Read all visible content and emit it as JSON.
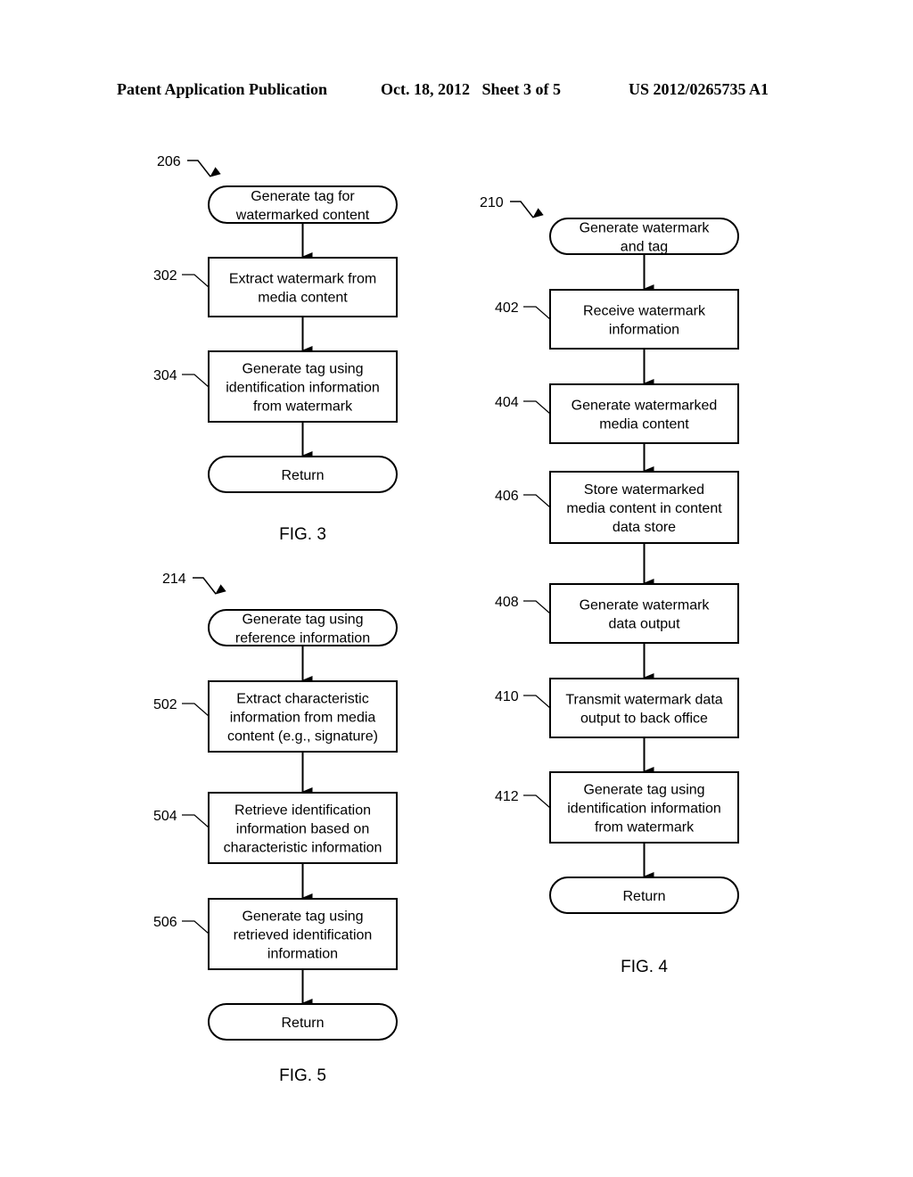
{
  "header": {
    "publication": "Patent Application Publication",
    "date_sheet": "Oct. 18, 2012   Sheet 3 of 5",
    "number": "US 2012/0265735 A1"
  },
  "figures": [
    {
      "id": "fig3",
      "caption": "FIG. 3",
      "entry_ref": "206",
      "nodes": [
        {
          "ref": "",
          "shape": "terminal",
          "lines": [
            "Generate tag for",
            "watermarked content"
          ]
        },
        {
          "ref": "302",
          "shape": "process",
          "lines": [
            "Extract watermark from",
            "media content"
          ]
        },
        {
          "ref": "304",
          "shape": "process",
          "lines": [
            "Generate tag using",
            "identification information",
            "from watermark"
          ]
        },
        {
          "ref": "",
          "shape": "terminal",
          "lines": [
            "Return"
          ]
        }
      ]
    },
    {
      "id": "fig4",
      "caption": "FIG. 4",
      "entry_ref": "210",
      "nodes": [
        {
          "ref": "",
          "shape": "terminal",
          "lines": [
            "Generate watermark",
            "and tag"
          ]
        },
        {
          "ref": "402",
          "shape": "process",
          "lines": [
            "Receive watermark",
            "information"
          ]
        },
        {
          "ref": "404",
          "shape": "process",
          "lines": [
            "Generate watermarked",
            "media content"
          ]
        },
        {
          "ref": "406",
          "shape": "process",
          "lines": [
            "Store watermarked",
            "media content in content",
            "data store"
          ]
        },
        {
          "ref": "408",
          "shape": "process",
          "lines": [
            "Generate watermark",
            "data output"
          ]
        },
        {
          "ref": "410",
          "shape": "process",
          "lines": [
            "Transmit watermark data",
            "output to back office"
          ]
        },
        {
          "ref": "412",
          "shape": "process",
          "lines": [
            "Generate tag using",
            "identification information",
            "from watermark"
          ]
        },
        {
          "ref": "",
          "shape": "terminal",
          "lines": [
            "Return"
          ]
        }
      ]
    },
    {
      "id": "fig5",
      "caption": "FIG. 5",
      "entry_ref": "214",
      "nodes": [
        {
          "ref": "",
          "shape": "terminal",
          "lines": [
            "Generate tag using",
            "reference information"
          ]
        },
        {
          "ref": "502",
          "shape": "process",
          "lines": [
            "Extract characteristic",
            "information from media",
            "content (e.g., signature)"
          ]
        },
        {
          "ref": "504",
          "shape": "process",
          "lines": [
            "Retrieve identification",
            "information based on",
            "characteristic information"
          ]
        },
        {
          "ref": "506",
          "shape": "process",
          "lines": [
            "Generate tag using",
            "retrieved identification",
            "information"
          ]
        },
        {
          "ref": "",
          "shape": "terminal",
          "lines": [
            "Return"
          ]
        }
      ]
    }
  ]
}
